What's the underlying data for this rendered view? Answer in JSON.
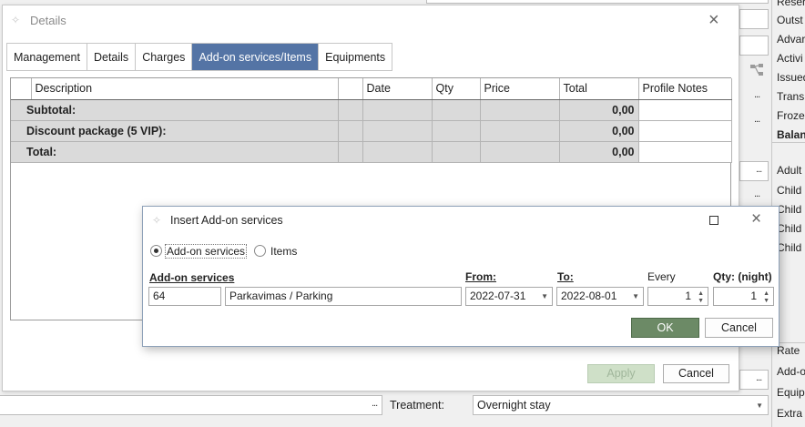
{
  "background": {
    "right_labels": [
      "Reser",
      "Outst",
      "Advar",
      "Activi",
      "Issued",
      "Trans",
      "Frozer",
      "Balanc",
      "Adult",
      "Child",
      "Child",
      "Child",
      "Child",
      "Rate",
      "Add-o",
      "Equip",
      "Extra"
    ],
    "dots": "...",
    "treatment_label": "Treatment:",
    "treatment_value": "Overnight stay"
  },
  "details": {
    "title": "Details",
    "tabs": [
      "Management",
      "Details",
      "Charges",
      "Add-on services/Items",
      "Equipments"
    ],
    "active_tab": "Add-on services/Items",
    "columns": [
      "Description",
      "",
      "Date",
      "Qty",
      "Price",
      "Total",
      "Profile Notes"
    ],
    "rows": [
      {
        "label": "Subtotal:",
        "total": "0,00"
      },
      {
        "label": "Discount package (5 VIP):",
        "total": "0,00"
      },
      {
        "label": "Total:",
        "total": "0,00"
      }
    ],
    "apply_label": "Apply",
    "cancel_label": "Cancel"
  },
  "dialog": {
    "title": "Insert Add-on services",
    "radio_addon": "Add-on services",
    "radio_items": "Items",
    "addon_label": "Add-on services",
    "code": "64",
    "service": "Parkavimas / Parking",
    "from_label": "From:",
    "from_value": "2022-07-31",
    "to_label": "To:",
    "to_value": "2022-08-01",
    "every_label": "Every",
    "every_value": "1",
    "qty_label": "Qty: (night)",
    "qty_value": "1",
    "ok_label": "OK",
    "cancel_label": "Cancel"
  },
  "colors": {
    "active_tab": "#5474a5",
    "ok_button": "#6c8a66",
    "apply_disabled": "#cfe0c8"
  }
}
